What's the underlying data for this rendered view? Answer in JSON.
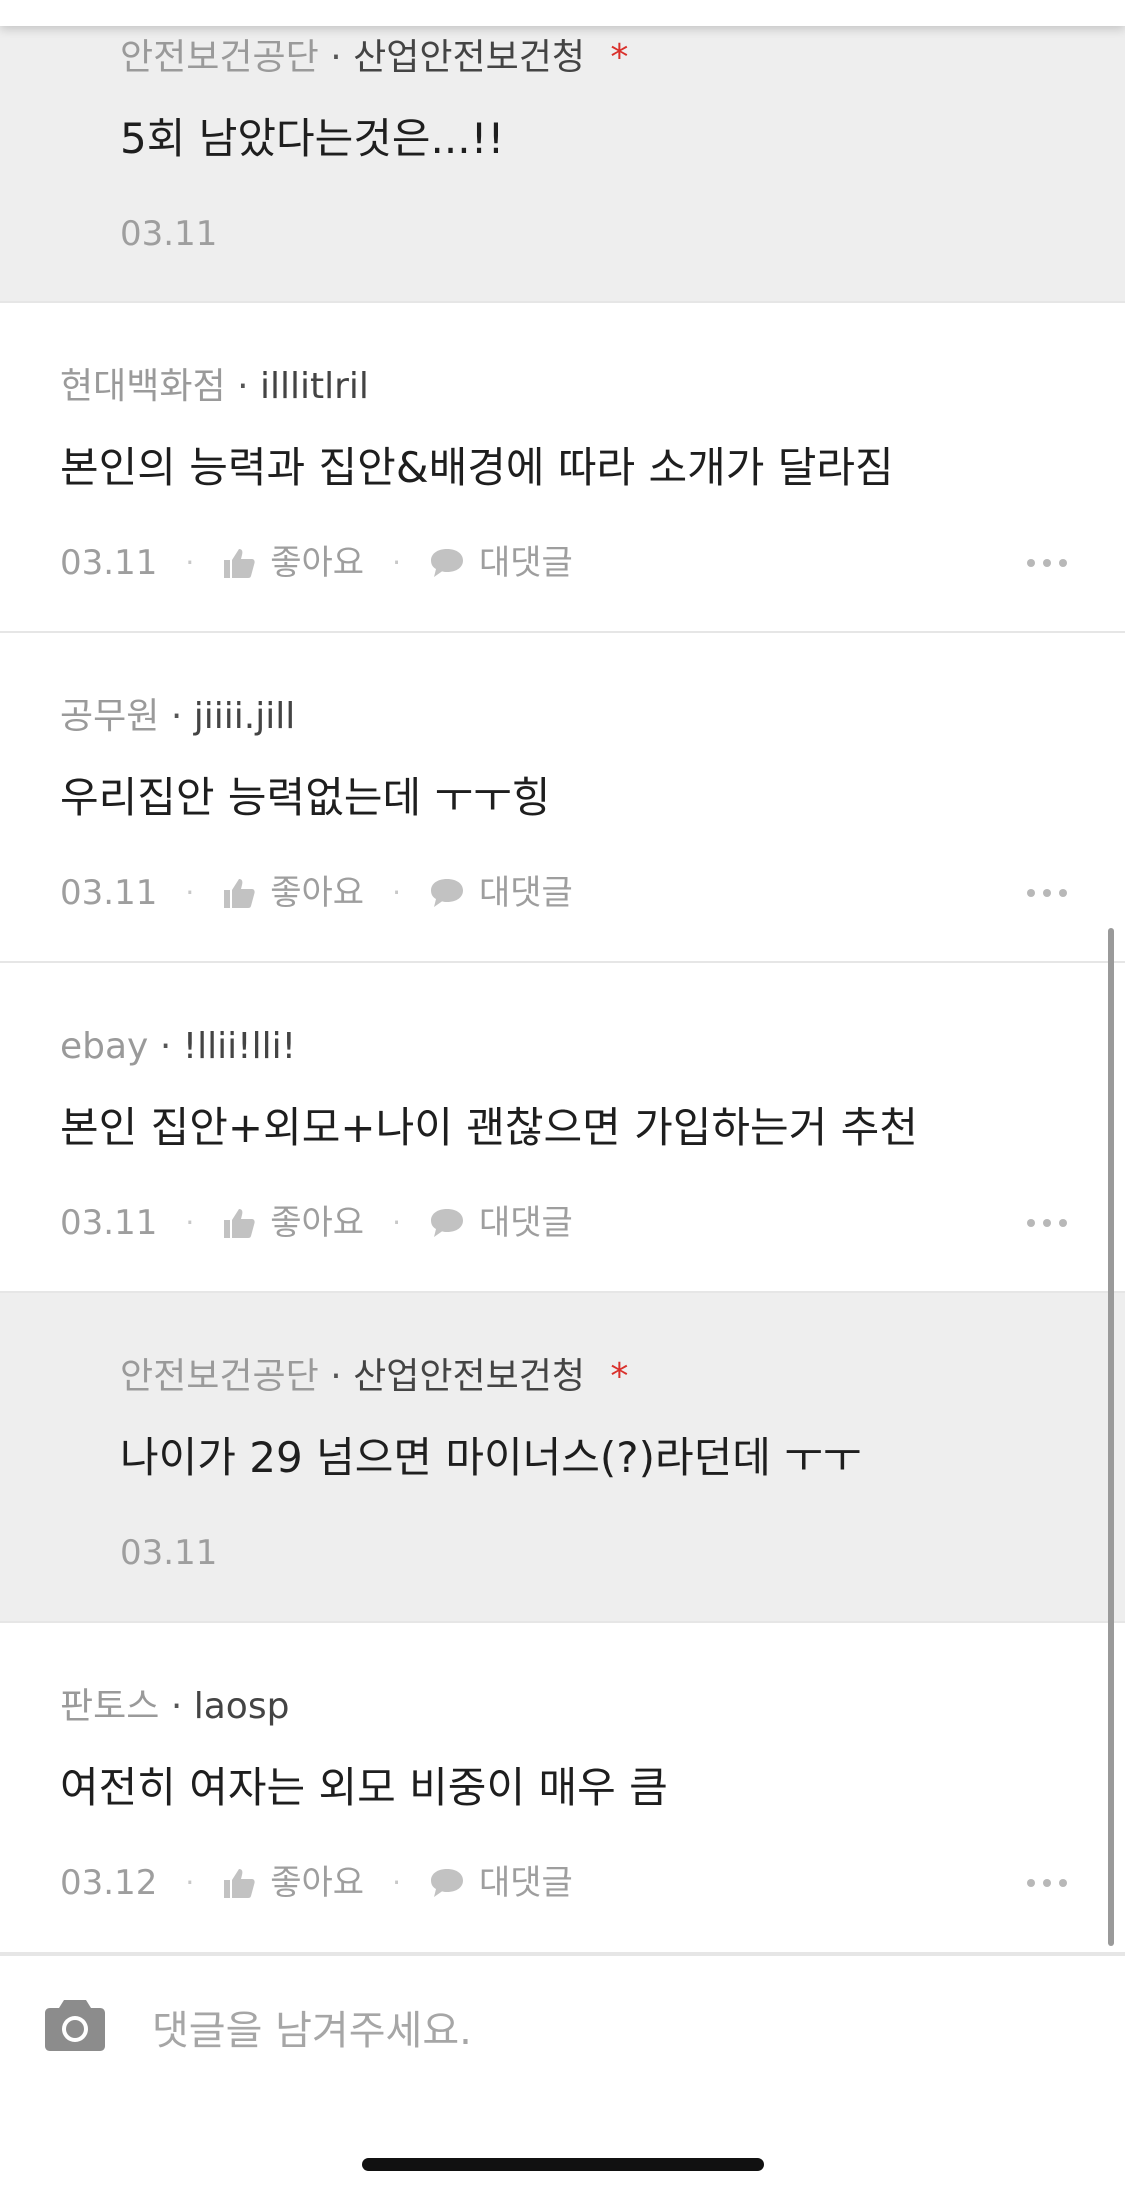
{
  "comments": [
    {
      "company": "안전보건공단",
      "nickname": "산업안전보건청",
      "author_mark": "*",
      "text": "5회 남았다는것은...!!",
      "date": "03.11"
    },
    {
      "company": "현대백화점",
      "nickname": "illlitlril",
      "text": "본인의 능력과 집안&배경에 따라 소개가 달라짐",
      "date": "03.11",
      "like_label": "좋아요",
      "reply_label": "대댓글"
    },
    {
      "company": "공무원",
      "nickname": "jiiii.jill",
      "text": "우리집안 능력없는데 ㅜㅜ힝",
      "date": "03.11",
      "like_label": "좋아요",
      "reply_label": "대댓글"
    },
    {
      "company": "ebay",
      "nickname": "!llii!lli!",
      "text": "본인 집안+외모+나이 괜찮으면 가입하는거 추천",
      "date": "03.11",
      "like_label": "좋아요",
      "reply_label": "대댓글"
    },
    {
      "company": "안전보건공단",
      "nickname": "산업안전보건청",
      "author_mark": "*",
      "text": "나이가 29 넘으면 마이너스(?)라던데 ㅜㅜ",
      "date": "03.11"
    },
    {
      "company": "판토스",
      "nickname": "laosp",
      "text": "여전히 여자는 외모 비중이 매우 큼",
      "date": "03.12",
      "like_label": "좋아요",
      "reply_label": "대댓글"
    }
  ],
  "separator": "·",
  "comment_input": {
    "placeholder": "댓글을 남겨주세요."
  },
  "icons": {
    "like": "thumbs-up-icon",
    "reply": "speech-bubble-icon",
    "more": "more-dots-icon",
    "camera": "camera-icon"
  },
  "colors": {
    "reply_bg": "#eeeeee",
    "author_mark": "#d9302b",
    "muted": "#9e9e9e"
  }
}
